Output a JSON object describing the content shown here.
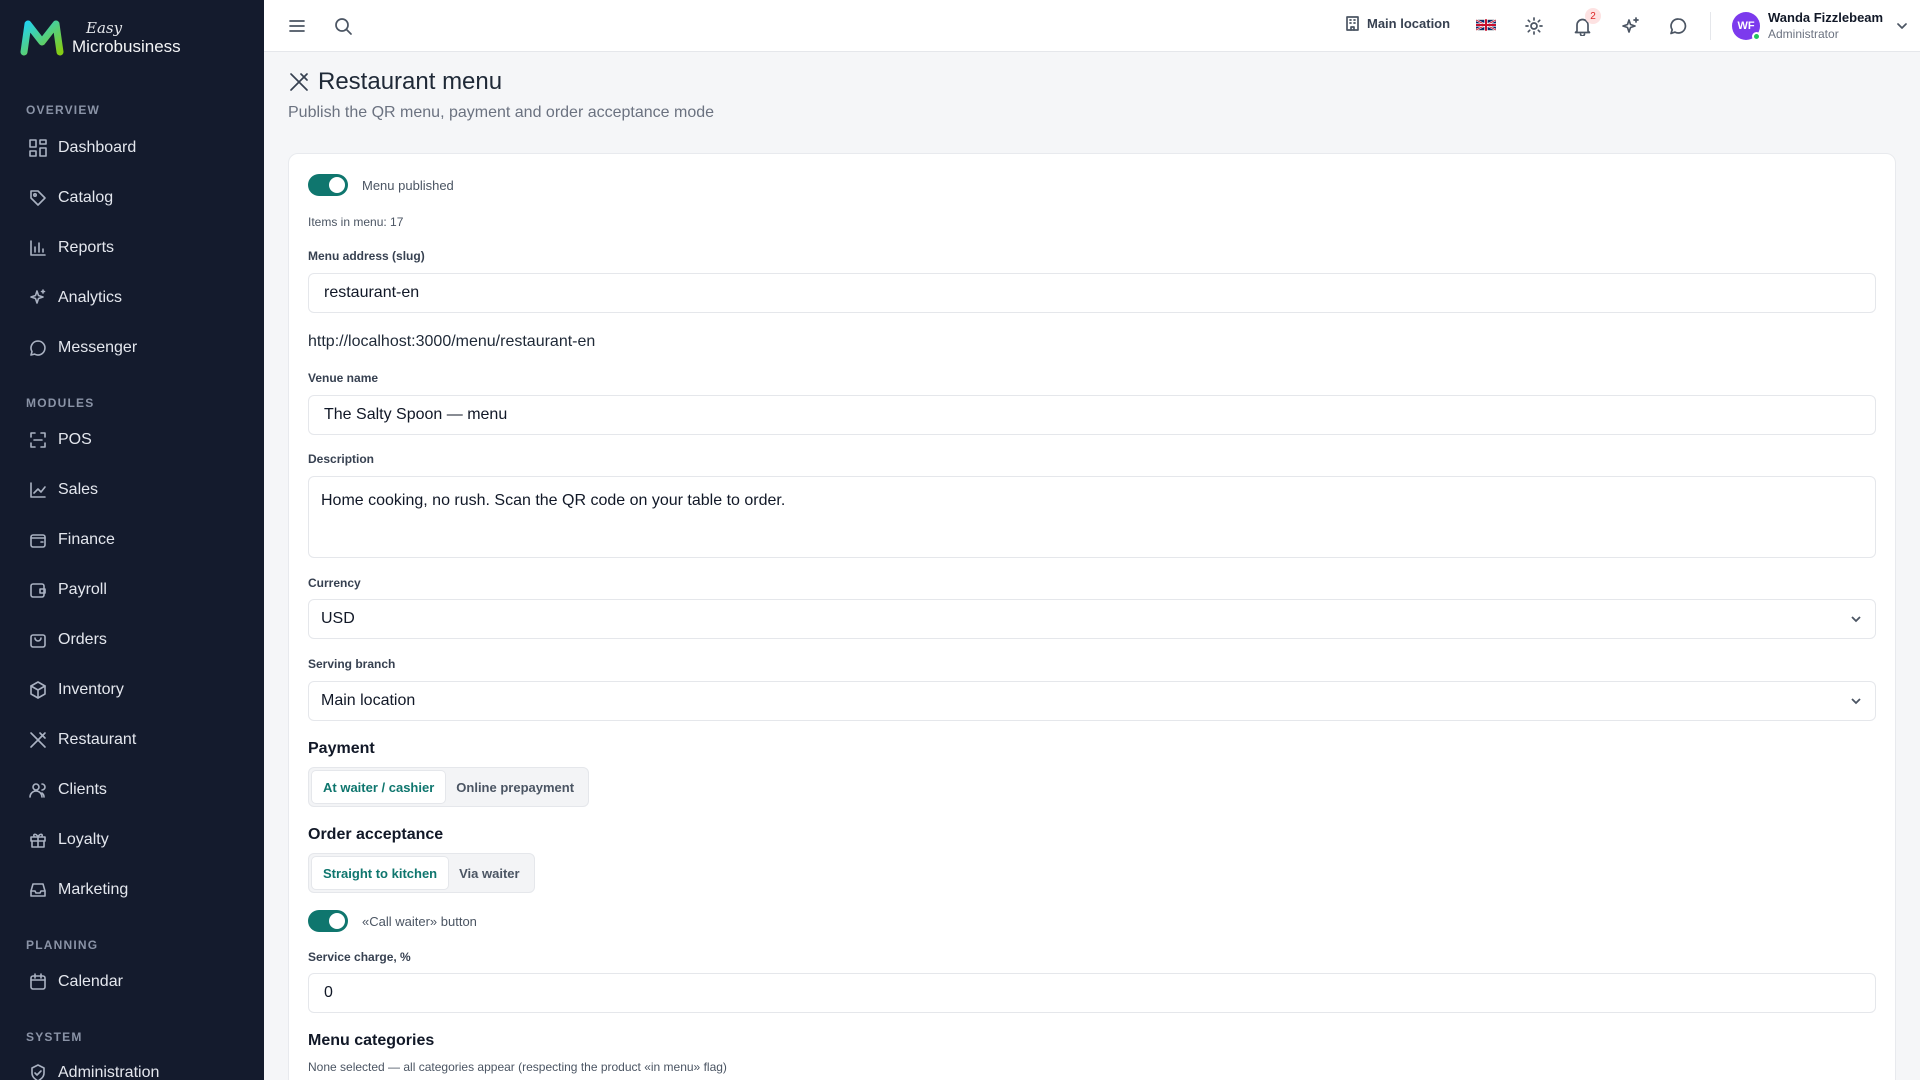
{
  "app": {
    "logo_easy": "Easy",
    "logo_name": "Microbusiness"
  },
  "sidebar": {
    "sections": {
      "overview": "OVERVIEW",
      "modules": "MODULES",
      "planning": "PLANNING",
      "system": "SYSTEM"
    },
    "items": {
      "dashboard": "Dashboard",
      "catalog": "Catalog",
      "reports": "Reports",
      "analytics": "Analytics",
      "messenger": "Messenger",
      "pos": "POS",
      "sales": "Sales",
      "finance": "Finance",
      "payroll": "Payroll",
      "orders": "Orders",
      "inventory": "Inventory",
      "restaurant": "Restaurant",
      "clients": "Clients",
      "loyalty": "Loyalty",
      "marketing": "Marketing",
      "calendar": "Calendar",
      "administration": "Administration"
    }
  },
  "header": {
    "location": "Main location",
    "notifications_count": "2",
    "user_initials": "WF",
    "user_name": "Wanda Fizzlebeam",
    "user_role": "Administrator"
  },
  "page": {
    "title": "Restaurant menu",
    "subtitle": "Publish the QR menu, payment and order acceptance mode"
  },
  "form": {
    "menu_published_label": "Menu published",
    "items_in_menu": "Items in menu: 17",
    "slug_label": "Menu address (slug)",
    "slug_value": "restaurant-en",
    "menu_url": "http://localhost:3000/menu/restaurant-en",
    "venue_label": "Venue name",
    "venue_value": "The Salty Spoon — menu",
    "description_label": "Description",
    "description_value": "Home cooking, no rush. Scan the QR code on your table to order.",
    "currency_label": "Currency",
    "currency_value": "USD",
    "branch_label": "Serving branch",
    "branch_value": "Main location",
    "payment_heading": "Payment",
    "payment_options": [
      "At waiter / cashier",
      "Online prepayment"
    ],
    "payment_selected": "At waiter / cashier",
    "order_heading": "Order acceptance",
    "order_options": [
      "Straight to kitchen",
      "Via waiter"
    ],
    "order_selected": "Straight to kitchen",
    "call_waiter_label": "«Call waiter» button",
    "service_label": "Service charge, %",
    "service_value": "0",
    "categories_heading": "Menu categories",
    "categories_hint": "None selected — all categories appear (respecting the product «in menu» flag)"
  },
  "colors": {
    "sidebar_bg": "#141b2d",
    "accent": "#0f766e",
    "avatar": "#7c3aed",
    "online": "#22c55e"
  }
}
